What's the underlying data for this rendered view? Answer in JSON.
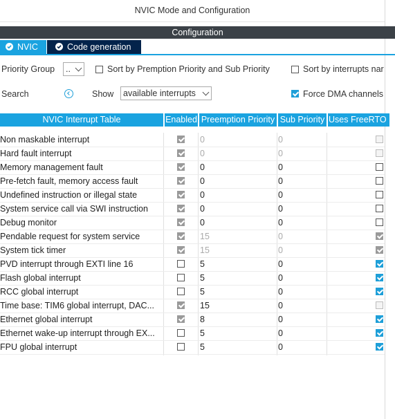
{
  "window": {
    "title": "NVIC Mode and Configuration"
  },
  "section": {
    "title": "Configuration"
  },
  "tabs": [
    {
      "label": "NVIC",
      "active": true
    },
    {
      "label": "Code generation",
      "active": false
    }
  ],
  "controls": {
    "priority_group_label": "Priority Group",
    "priority_group_value": "..",
    "sort_premption_label": "Sort by Premption Priority and Sub Priority",
    "sort_interrupts_label": "Sort by interrupts nar",
    "search_label": "Search",
    "show_label": "Show",
    "show_value": "available interrupts",
    "force_dma_label": "Force DMA channels",
    "force_dma_checked": true
  },
  "table": {
    "headers": [
      "NVIC Interrupt Table",
      "Enabled",
      "Preemption Priority",
      "Sub Priority",
      "Uses FreeRTO"
    ],
    "rows": [
      {
        "name": "Non maskable interrupt",
        "enabled": "gray",
        "preemption": "0",
        "sub": "0",
        "pre_dim": true,
        "freertos": "dis"
      },
      {
        "name": "Hard fault interrupt",
        "enabled": "gray",
        "preemption": "0",
        "sub": "0",
        "pre_dim": true,
        "freertos": "dis"
      },
      {
        "name": "Memory management fault",
        "enabled": "gray",
        "preemption": "0",
        "sub": "0",
        "pre_dim": false,
        "freertos": "off"
      },
      {
        "name": "Pre-fetch fault, memory access fault",
        "enabled": "gray",
        "preemption": "0",
        "sub": "0",
        "pre_dim": false,
        "freertos": "off"
      },
      {
        "name": "Undefined instruction or illegal state",
        "enabled": "gray",
        "preemption": "0",
        "sub": "0",
        "pre_dim": false,
        "freertos": "off"
      },
      {
        "name": "System service call via SWI instruction",
        "enabled": "gray",
        "preemption": "0",
        "sub": "0",
        "pre_dim": false,
        "freertos": "off"
      },
      {
        "name": "Debug monitor",
        "enabled": "gray",
        "preemption": "0",
        "sub": "0",
        "pre_dim": false,
        "freertos": "off"
      },
      {
        "name": "Pendable request for system service",
        "enabled": "gray",
        "preemption": "15",
        "sub": "0",
        "pre_dim": true,
        "freertos": "gray"
      },
      {
        "name": "System tick timer",
        "enabled": "gray",
        "preemption": "15",
        "sub": "0",
        "pre_dim": true,
        "freertos": "gray"
      },
      {
        "name": "PVD interrupt through EXTI line 16",
        "enabled": "off",
        "preemption": "5",
        "sub": "0",
        "pre_dim": false,
        "freertos": "on"
      },
      {
        "name": "Flash global interrupt",
        "enabled": "off",
        "preemption": "5",
        "sub": "0",
        "pre_dim": false,
        "freertos": "on"
      },
      {
        "name": "RCC global interrupt",
        "enabled": "off",
        "preemption": "5",
        "sub": "0",
        "pre_dim": false,
        "freertos": "on"
      },
      {
        "name": "Time base: TIM6 global interrupt, DAC...",
        "enabled": "gray",
        "preemption": "15",
        "sub": "0",
        "pre_dim": false,
        "freertos": "dis"
      },
      {
        "name": "Ethernet global interrupt",
        "enabled": "gray",
        "preemption": "8",
        "sub": "0",
        "pre_dim": false,
        "freertos": "on"
      },
      {
        "name": "Ethernet wake-up interrupt through EX...",
        "enabled": "off",
        "preemption": "5",
        "sub": "0",
        "pre_dim": false,
        "freertos": "on"
      },
      {
        "name": "FPU global interrupt",
        "enabled": "off",
        "preemption": "5",
        "sub": "0",
        "pre_dim": false,
        "freertos": "on"
      }
    ]
  },
  "colors": {
    "accent": "#1aa3e0",
    "tab_dark": "#03234b",
    "bar_dark": "#3b4147",
    "check_blue": "#1e9fd8"
  }
}
